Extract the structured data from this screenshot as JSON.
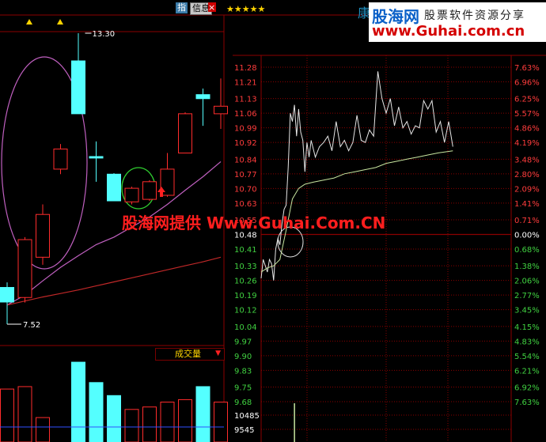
{
  "toolbar": {
    "hi_label": "指",
    "info_label": "信息",
    "close_label": "×",
    "stars": "★★★★★"
  },
  "header": {
    "stock_char": "康"
  },
  "brand": {
    "name": "股海网",
    "subtitle": "股票软件资源分享",
    "url": "www.Guhai.com.cn"
  },
  "watermark": {
    "text": "股海网提供 Www.Guhai.Com.CN"
  },
  "volume_button": {
    "label": "成交量",
    "arrow": "▼"
  },
  "colors": {
    "up": "#ff2c2c",
    "down": "#54ffff",
    "ma_short": "#c060c0",
    "ma_long": "#c02828",
    "grid": "#8b0000",
    "price_line": "#e6e6e6",
    "avg_line": "#c8e6a0",
    "axis_label": "#ff3c3c",
    "axis_label_down": "#40d040"
  },
  "chart_data": [
    {
      "type": "candlestick",
      "annotations": [
        {
          "text": "13.30",
          "label": "high"
        },
        {
          "text": "7.52",
          "label": "low"
        }
      ],
      "candles": [
        {
          "o": 7.96,
          "c": 8.25,
          "h": 8.35,
          "l": 7.52,
          "dir": "down"
        },
        {
          "o": 8.05,
          "c": 9.2,
          "h": 9.25,
          "l": 7.95,
          "dir": "up"
        },
        {
          "o": 8.85,
          "c": 9.7,
          "h": 9.9,
          "l": 8.7,
          "dir": "up"
        },
        {
          "o": 10.6,
          "c": 11.0,
          "h": 11.1,
          "l": 10.5,
          "dir": "up"
        },
        {
          "o": 11.7,
          "c": 12.75,
          "h": 13.3,
          "l": 11.7,
          "dir": "down"
        },
        {
          "o": 10.82,
          "c": 10.85,
          "h": 11.15,
          "l": 10.35,
          "dir": "down"
        },
        {
          "o": 10.5,
          "c": 9.97,
          "h": 10.52,
          "l": 9.97,
          "dir": "down"
        },
        {
          "o": 9.95,
          "c": 10.22,
          "h": 10.25,
          "l": 9.9,
          "dir": "up"
        },
        {
          "o": 10.0,
          "c": 10.35,
          "h": 10.38,
          "l": 9.97,
          "dir": "up"
        },
        {
          "o": 10.08,
          "c": 10.6,
          "h": 10.92,
          "l": 10.05,
          "dir": "up"
        },
        {
          "o": 10.92,
          "c": 11.7,
          "h": 11.73,
          "l": 10.92,
          "dir": "up"
        },
        {
          "o": 12.0,
          "c": 12.08,
          "h": 12.2,
          "l": 11.46,
          "dir": "down"
        },
        {
          "o": 11.7,
          "c": 11.85,
          "h": 12.4,
          "l": 11.4,
          "dir": "up"
        }
      ],
      "ma_short": [
        7.9,
        8.1,
        8.38,
        8.65,
        8.88,
        9.1,
        9.25,
        9.45,
        9.65,
        9.9,
        10.18,
        10.45,
        10.75
      ],
      "ma_long": [
        7.9,
        7.98,
        8.06,
        8.13,
        8.2,
        8.28,
        8.36,
        8.44,
        8.52,
        8.6,
        8.68,
        8.76,
        8.85
      ],
      "volume": [
        {
          "v": 0.65,
          "dir": "up"
        },
        {
          "v": 0.68,
          "dir": "up"
        },
        {
          "v": 0.3,
          "dir": "up"
        },
        {
          "v": 0.0,
          "dir": "up"
        },
        {
          "v": 0.98,
          "dir": "down"
        },
        {
          "v": 0.73,
          "dir": "down"
        },
        {
          "v": 0.57,
          "dir": "down"
        },
        {
          "v": 0.4,
          "dir": "up"
        },
        {
          "v": 0.43,
          "dir": "up"
        },
        {
          "v": 0.49,
          "dir": "up"
        },
        {
          "v": 0.52,
          "dir": "up"
        },
        {
          "v": 0.68,
          "dir": "down"
        },
        {
          "v": 0.49,
          "dir": "up"
        }
      ]
    },
    {
      "type": "line",
      "prev_close": 10.48,
      "ylim": [
        9.68,
        11.28
      ],
      "price_ticks": [
        "11.28",
        "11.21",
        "11.13",
        "11.06",
        "10.99",
        "10.92",
        "10.84",
        "10.77",
        "10.70",
        "10.63",
        "10.55",
        "10.48",
        "10.41",
        "10.33",
        "10.26",
        "10.19",
        "10.12",
        "10.04",
        "9.97",
        "9.90",
        "9.83",
        "9.75",
        "9.68"
      ],
      "pct_ticks": [
        "7.63%",
        "6.96%",
        "6.25%",
        "5.57%",
        "4.86%",
        "4.19%",
        "3.48%",
        "2.80%",
        "2.09%",
        "1.41%",
        "0.71%",
        "0.00%",
        "0.68%",
        "1.38%",
        "2.06%",
        "2.77%",
        "3.45%",
        "4.15%",
        "4.83%",
        "5.54%",
        "6.21%",
        "6.92%",
        "7.63%"
      ],
      "volume_ticks": [
        "10485",
        "9545"
      ],
      "price": [
        [
          0,
          10.27
        ],
        [
          2,
          10.36
        ],
        [
          4,
          10.33
        ],
        [
          6,
          10.3
        ],
        [
          8,
          10.36
        ],
        [
          10,
          10.34
        ],
        [
          12,
          10.26
        ],
        [
          14,
          10.41
        ],
        [
          16,
          10.46
        ],
        [
          18,
          10.43
        ],
        [
          20,
          10.53
        ],
        [
          22,
          10.6
        ],
        [
          24,
          10.62
        ],
        [
          26,
          10.8
        ],
        [
          28,
          11.06
        ],
        [
          30,
          11.02
        ],
        [
          32,
          11.1
        ],
        [
          34,
          10.95
        ],
        [
          36,
          11.08
        ],
        [
          38,
          10.97
        ],
        [
          40,
          10.93
        ],
        [
          42,
          10.78
        ],
        [
          44,
          10.92
        ],
        [
          46,
          10.85
        ],
        [
          48,
          10.93
        ],
        [
          52,
          10.85
        ],
        [
          56,
          10.9
        ],
        [
          60,
          10.92
        ],
        [
          64,
          10.95
        ],
        [
          68,
          10.88
        ],
        [
          72,
          11.02
        ],
        [
          76,
          10.9
        ],
        [
          80,
          10.93
        ],
        [
          84,
          10.88
        ],
        [
          88,
          10.92
        ],
        [
          92,
          11.05
        ],
        [
          96,
          10.93
        ],
        [
          100,
          10.92
        ],
        [
          104,
          10.98
        ],
        [
          108,
          10.95
        ],
        [
          112,
          11.26
        ],
        [
          116,
          11.13
        ],
        [
          120,
          11.06
        ],
        [
          124,
          11.13
        ],
        [
          128,
          11.0
        ],
        [
          132,
          11.09
        ],
        [
          136,
          10.99
        ],
        [
          140,
          11.02
        ],
        [
          144,
          10.96
        ],
        [
          148,
          11.0
        ],
        [
          152,
          10.99
        ],
        [
          156,
          11.12
        ],
        [
          160,
          11.08
        ],
        [
          164,
          11.12
        ],
        [
          168,
          10.97
        ],
        [
          172,
          11.02
        ],
        [
          176,
          10.92
        ],
        [
          180,
          11.02
        ],
        [
          184,
          10.9
        ]
      ],
      "avg": [
        [
          0,
          10.3
        ],
        [
          6,
          10.32
        ],
        [
          12,
          10.33
        ],
        [
          18,
          10.36
        ],
        [
          24,
          10.5
        ],
        [
          30,
          10.65
        ],
        [
          36,
          10.7
        ],
        [
          42,
          10.72
        ],
        [
          50,
          10.73
        ],
        [
          60,
          10.74
        ],
        [
          70,
          10.75
        ],
        [
          80,
          10.77
        ],
        [
          90,
          10.78
        ],
        [
          100,
          10.79
        ],
        [
          110,
          10.8
        ],
        [
          120,
          10.82
        ],
        [
          130,
          10.83
        ],
        [
          140,
          10.84
        ],
        [
          150,
          10.85
        ],
        [
          160,
          10.86
        ],
        [
          170,
          10.87
        ],
        [
          184,
          10.88
        ]
      ],
      "volume": [
        {
          "t": 32,
          "v": 0.98
        }
      ]
    }
  ]
}
